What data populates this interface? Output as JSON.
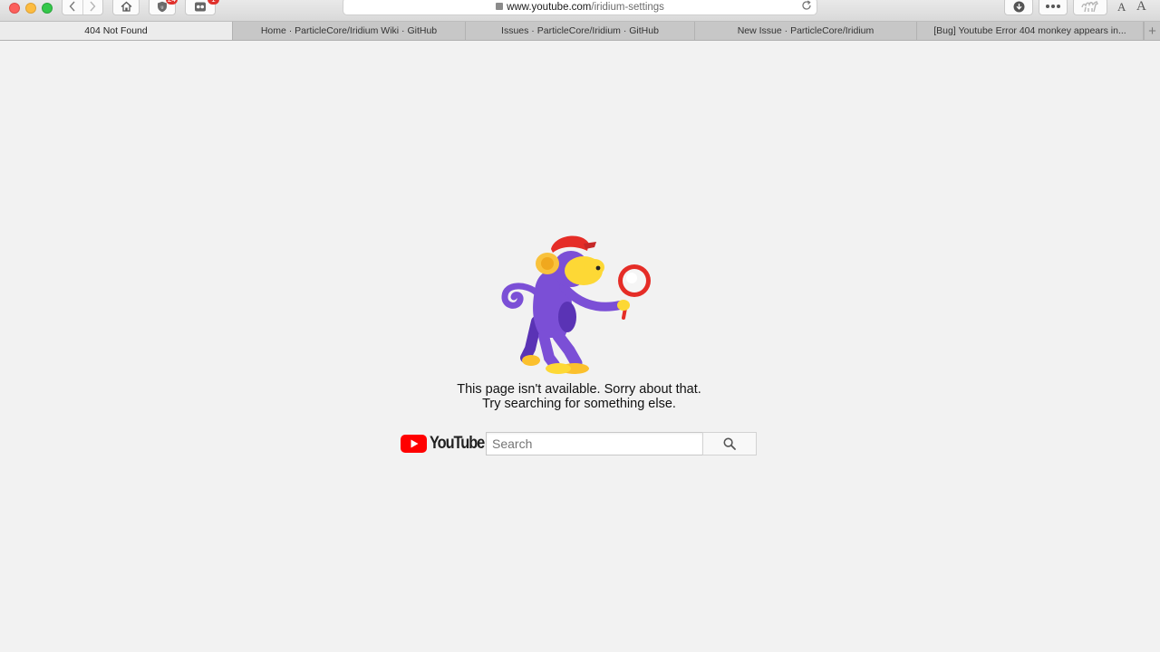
{
  "browser": {
    "url_host": "www.youtube.com",
    "url_path": "/iridium-settings",
    "badges": {
      "ublock": "24",
      "ghostery": "1"
    },
    "font_small_label": "A",
    "font_large_label": "A",
    "new_tab_label": "+"
  },
  "tabs": [
    {
      "label": "404 Not Found",
      "active": true
    },
    {
      "label": "Home · ParticleCore/Iridium Wiki · GitHub",
      "active": false
    },
    {
      "label": "Issues · ParticleCore/Iridium · GitHub",
      "active": false
    },
    {
      "label": "New Issue · ParticleCore/Iridium",
      "active": false
    },
    {
      "label": "[Bug] Youtube Error 404 monkey appears in...",
      "active": false
    }
  ],
  "page": {
    "message_line1": "This page isn't available. Sorry about that.",
    "message_line2": "Try searching for something else.",
    "logo_text": "YouTube",
    "search_placeholder": "Search"
  },
  "colors": {
    "youtube_red": "#ff0000",
    "monkey_purple": "#7b4fd6",
    "monkey_yellow": "#fdd835",
    "cap_red": "#e52d27"
  }
}
